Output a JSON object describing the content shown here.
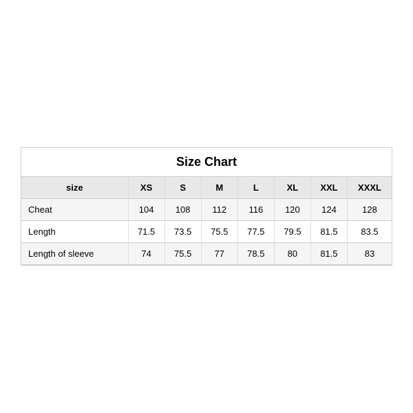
{
  "chart": {
    "title": "Size Chart",
    "headers": [
      "size",
      "XS",
      "S",
      "M",
      "L",
      "XL",
      "XXL",
      "XXXL"
    ],
    "rows": [
      {
        "label": "Cheat",
        "values": [
          "104",
          "108",
          "112",
          "116",
          "120",
          "124",
          "128"
        ]
      },
      {
        "label": "Length",
        "values": [
          "71.5",
          "73.5",
          "75.5",
          "77.5",
          "79.5",
          "81.5",
          "83.5"
        ]
      },
      {
        "label": "Length of sleeve",
        "values": [
          "74",
          "75.5",
          "77",
          "78.5",
          "80",
          "81.5",
          "83"
        ]
      }
    ]
  }
}
